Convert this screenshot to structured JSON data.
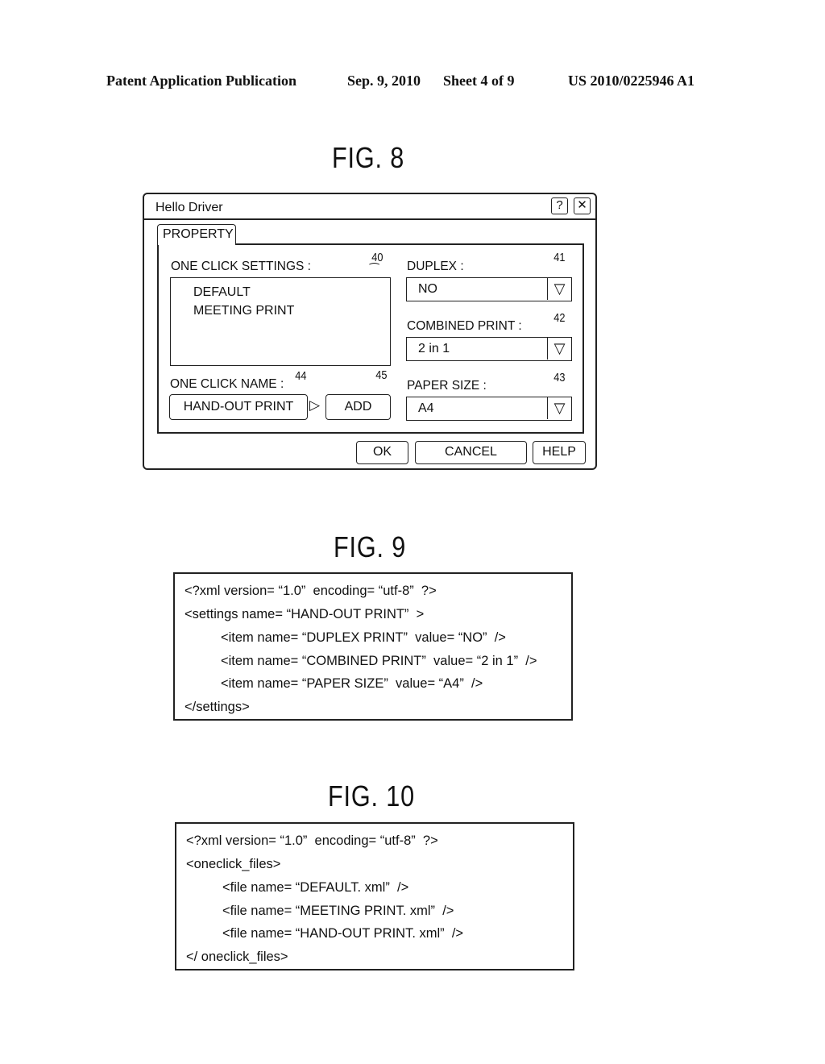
{
  "header": {
    "publication": "Patent Application Publication",
    "date": "Sep. 9, 2010",
    "sheet": "Sheet 4 of 9",
    "number": "US 2010/0225946 A1"
  },
  "fig8": {
    "label": "FIG. 8",
    "dialog": {
      "title": "Hello Driver",
      "help_icon": "?",
      "close_icon": "✕",
      "tab": "PROPERTY",
      "one_click_settings_label": "ONE CLICK SETTINGS :",
      "one_click_settings_ref": "40",
      "one_click_settings_items": [
        "DEFAULT",
        "MEETING PRINT"
      ],
      "one_click_name_label": "ONE CLICK NAME :",
      "one_click_name_ref": "44",
      "one_click_name_value": "HAND-OUT PRINT",
      "arrow_icon": "▷",
      "add_label": "ADD",
      "add_ref": "45",
      "duplex_label": "DUPLEX :",
      "duplex_ref": "41",
      "duplex_value": "NO",
      "combined_label": "COMBINED PRINT :",
      "combined_ref": "42",
      "combined_value": "2 in 1",
      "paper_label": "PAPER SIZE :",
      "paper_ref": "43",
      "paper_value": "A4",
      "dropdown_icon": "▽",
      "ok_label": "OK",
      "cancel_label": "CANCEL",
      "help_label": "HELP"
    }
  },
  "fig9": {
    "label": "FIG. 9",
    "lines": [
      "<?xml version= “1.0”  encoding= “utf-8”  ?>",
      "<settings name= “HAND-OUT PRINT”  >",
      "<item name= “DUPLEX PRINT”  value= “NO”  />",
      "<item name= “COMBINED PRINT”  value= “2 in 1”  />",
      "<item name= “PAPER SIZE”  value= “A4”  />",
      "</settings>"
    ]
  },
  "fig10": {
    "label": "FIG. 10",
    "lines": [
      "<?xml version= “1.0”  encoding= “utf-8”  ?>",
      "<oneclick_files>",
      "<file name= “DEFAULT. xml”  />",
      "<file name= “MEETING PRINT. xml”  />",
      "<file name= “HAND-OUT PRINT. xml”  />",
      "</ oneclick_files>"
    ]
  }
}
